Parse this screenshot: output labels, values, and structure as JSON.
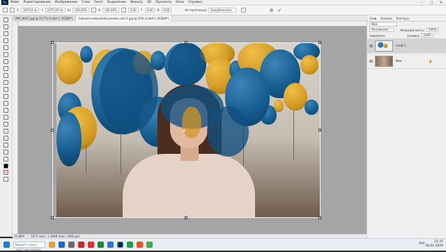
{
  "menubar": {
    "app_logo": "Ps",
    "items": [
      "Файл",
      "Редактирование",
      "Изображение",
      "Слои",
      "Текст",
      "Выделение",
      "Фильтр",
      "3D",
      "Просмотр",
      "Окно",
      "Справка"
    ]
  },
  "optionsbar": {
    "x_value": "3470,0 пк",
    "y_value": "2475,00 пк",
    "w_value": "100,00%",
    "h_value": "100,00%",
    "angle_value": "0,00",
    "h_skew": "0,00",
    "v_skew": "0,00",
    "interpolation_label": "Интерполяция:",
    "interpolation_value": "Бикубическая"
  },
  "tabs": [
    {
      "label": "IMG_9047.jpg @ 25,7% (Слой 1, RGB/8*)",
      "active": false
    },
    {
      "label": "balloons-www.photo-presets.com-1.jpg @ 50% (Слой 1, RGB/8*)",
      "active": true
    }
  ],
  "statusbar": {
    "zoom": "25,68%",
    "info": "5472 пикс. x 3648 пикс. (300 ppi)"
  },
  "layers_panel": {
    "tabs": [
      "Слои",
      "Каналы",
      "Контуры"
    ],
    "filter_label": "Вид",
    "blend_mode": "Умножение",
    "opacity_label": "Непрозрачность:",
    "opacity_value": "100%",
    "lock_label": "Закрепить:",
    "fill_label": "Заливка:",
    "fill_value": "100%",
    "layers": [
      {
        "name": "Слой 1",
        "selected": true
      },
      {
        "name": "Фон",
        "selected": false
      }
    ]
  },
  "taskbar": {
    "search_placeholder": "Введите здесь текст для поиска",
    "lang": "РУС",
    "time": "21:37",
    "date": "28.01.2020"
  },
  "colors": {
    "blue_balloon": "#135a8c",
    "yellow_balloon": "#d29a22",
    "workspace": "#a5a5a5"
  }
}
